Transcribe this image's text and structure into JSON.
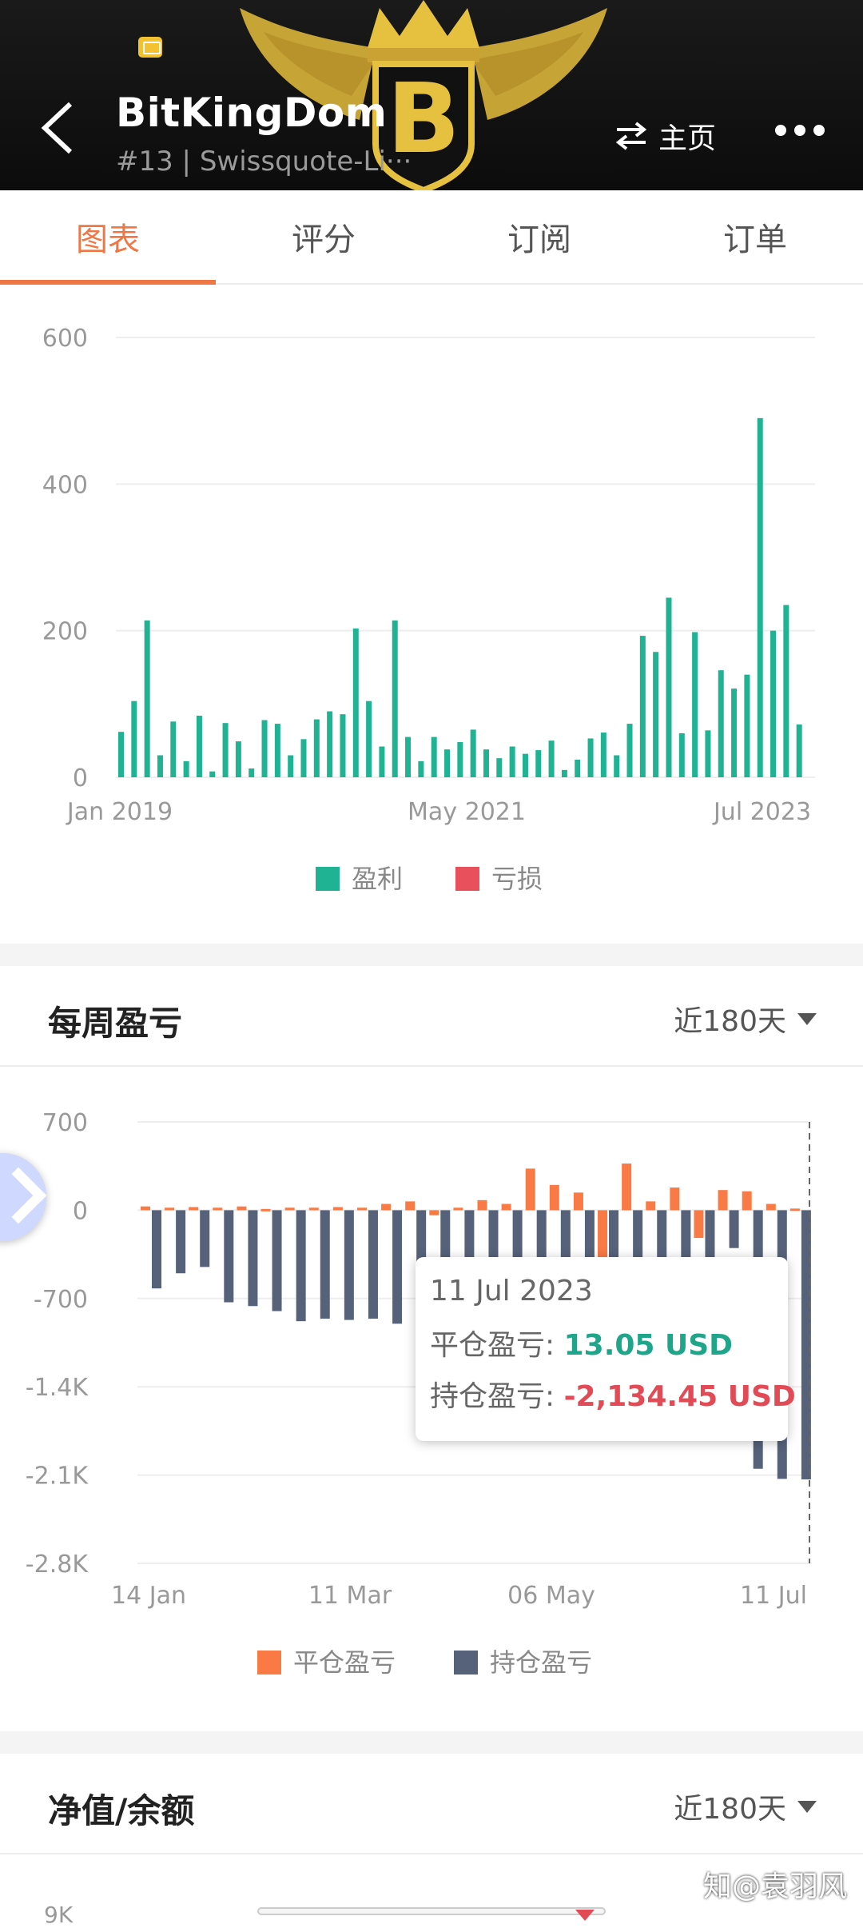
{
  "header": {
    "title": "BitKingDom",
    "subtitle": "#13 | Swissquote-Li···",
    "home_label": "主页"
  },
  "tabs": [
    {
      "label": "图表",
      "active": true
    },
    {
      "label": "评分",
      "active": false
    },
    {
      "label": "订阅",
      "active": false
    },
    {
      "label": "订单",
      "active": false
    }
  ],
  "colors": {
    "accent": "#ee7743",
    "profit": "#1fb394",
    "loss": "#e8505b",
    "closed": "#f97a45",
    "open": "#56627a"
  },
  "chart_data": [
    {
      "type": "bar",
      "x_labels": [
        "Jan 2019",
        "May 2021",
        "Jul 2023"
      ],
      "yticks": [
        0,
        200,
        400,
        600
      ],
      "ylim": [
        0,
        600
      ],
      "legend": [
        "盈利",
        "亏损"
      ],
      "legend_position": "bottom",
      "series": [
        {
          "name": "盈利",
          "values": [
            62,
            104,
            214,
            30,
            76,
            22,
            84,
            8,
            74,
            49,
            12,
            78,
            73,
            30,
            52,
            79,
            90,
            86,
            203,
            104,
            42,
            214,
            55,
            22,
            55,
            38,
            48,
            65,
            38,
            26,
            42,
            32,
            37,
            50,
            10,
            24,
            53,
            61,
            30,
            73,
            193,
            171,
            245,
            60,
            198,
            64,
            146,
            121,
            140,
            490,
            200,
            235,
            72
          ]
        },
        {
          "name": "亏损",
          "values": []
        }
      ]
    },
    {
      "type": "bar",
      "title": "每周盈亏",
      "period": "近180天",
      "x_labels": [
        "14 Jan",
        "11 Mar",
        "06 May",
        "11 Jul"
      ],
      "yticks": [
        "700",
        "0",
        "-700",
        "-1.4K",
        "-2.1K",
        "-2.8K"
      ],
      "ylim": [
        -2800,
        700
      ],
      "legend": [
        "平仓盈亏",
        "持仓盈亏"
      ],
      "legend_position": "bottom",
      "series": [
        {
          "name": "平仓盈亏",
          "values": [
            30,
            20,
            25,
            20,
            30,
            10,
            20,
            20,
            25,
            20,
            50,
            70,
            -40,
            20,
            80,
            50,
            330,
            200,
            140,
            -380,
            370,
            70,
            180,
            -220,
            160,
            150,
            50,
            13.05
          ]
        },
        {
          "name": "持仓盈亏",
          "values": [
            -620,
            -500,
            -450,
            -730,
            -760,
            -800,
            -880,
            -860,
            -870,
            -860,
            -900,
            -880,
            -800,
            -700,
            -500,
            -600,
            -820,
            -900,
            -650,
            -550,
            -400,
            -550,
            -620,
            -500,
            -300,
            -2050,
            -2130,
            -2134.45
          ]
        }
      ],
      "tooltip": {
        "date": "11 Jul 2023",
        "closed_label": "平仓盈亏:",
        "closed_value": "13.05 USD",
        "open_label": "持仓盈亏:",
        "open_value": "-2,134.45 USD"
      }
    }
  ],
  "section3": {
    "title": "净值/余额",
    "period": "近180天",
    "first_tick": "9K"
  },
  "watermark": "知@袁羽风"
}
